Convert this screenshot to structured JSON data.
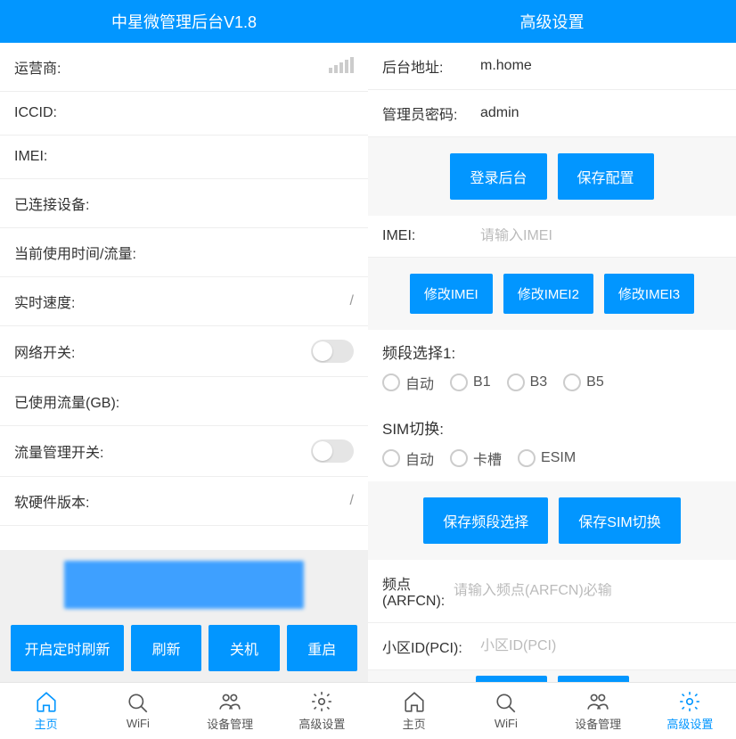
{
  "left": {
    "title": "中星微管理后台V1.8",
    "rows": {
      "carrier_label": "运营商:",
      "iccid_label": "ICCID:",
      "imei_label": "IMEI:",
      "connected_label": "已连接设备:",
      "usage_time_label": "当前使用时间/流量:",
      "realtime_speed_label": "实时速度:",
      "realtime_speed_value": "/",
      "net_switch_label": "网络开关:",
      "used_data_label": "已使用流量(GB):",
      "data_mgmt_label": "流量管理开关:",
      "version_label": "软硬件版本:",
      "version_value": "/"
    },
    "buttons": {
      "auto_refresh": "开启定时刷新",
      "refresh": "刷新",
      "shutdown": "关机",
      "reboot": "重启"
    }
  },
  "right": {
    "title": "高级设置",
    "backend_addr_label": "后台地址:",
    "backend_addr_value": "m.home",
    "admin_pwd_label": "管理员密码:",
    "admin_pwd_value": "admin",
    "login_btn": "登录后台",
    "save_config_btn": "保存配置",
    "imei_label": "IMEI:",
    "imei_placeholder": "请输入IMEI",
    "modify_imei_btn": "修改IMEI",
    "modify_imei2_btn": "修改IMEI2",
    "modify_imei3_btn": "修改IMEI3",
    "band_select_title": "频段选择1:",
    "band_options": {
      "auto": "自动",
      "b1": "B1",
      "b3": "B3",
      "b5": "B5"
    },
    "sim_switch_title": "SIM切换:",
    "sim_options": {
      "auto": "自动",
      "slot": "卡槽",
      "esim": "ESIM"
    },
    "save_band_btn": "保存频段选择",
    "save_sim_btn": "保存SIM切换",
    "arfcn_label": "频点(ARFCN):",
    "arfcn_placeholder": "请输入频点(ARFCN)必输",
    "pci_label": "小区ID(PCI):",
    "pci_placeholder": "小区ID(PCI)"
  },
  "tabs": {
    "home": "主页",
    "wifi": "WiFi",
    "devices": "设备管理",
    "advanced": "高级设置"
  }
}
